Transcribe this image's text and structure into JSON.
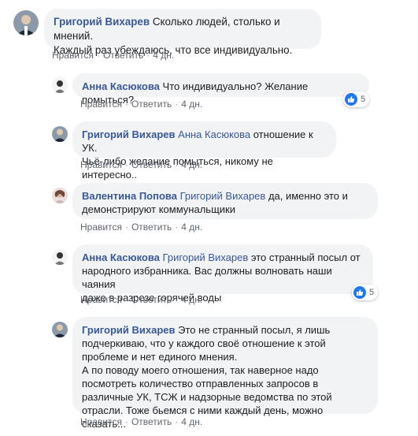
{
  "comments": [
    {
      "author": "Григорий Вихарев",
      "mention": "",
      "text": " Сколько людей, столько и мнений.\nКаждый раз убеждаюсь, что все индивидуально.",
      "like": "Нравится",
      "reply": "Ответить",
      "time": "4 дн.",
      "reactions": ""
    },
    {
      "author": "Анна Касюкова",
      "mention": "",
      "text": " Что индивидуально? Желание помыться?",
      "like": "Нравится",
      "reply": "Ответить",
      "time": "4 дн.",
      "reactions": "5"
    },
    {
      "author": "Григорий Вихарев",
      "mention": " Анна Касюкова",
      "text": " отношение к УК.\nЧьё-либо желание помыться, никому не интересно..",
      "like": "Нравится",
      "reply": "Ответить",
      "time": "4 дн.",
      "reactions": ""
    },
    {
      "author": "Валентина Попова",
      "mention": " Григорий Вихарев",
      "text": " да, именно это и\nдемонстрируют коммунальщики",
      "like": "Нравится",
      "reply": "Ответить",
      "time": "4 дн.",
      "reactions": ""
    },
    {
      "author": "Анна Касюкова",
      "mention": " Григорий Вихарев",
      "text": " это странный посыл от\nнародного избранника. Вас должны волновать наши чаяния\nдаже в разрезе горячей воды",
      "like": "Нравится",
      "reply": "Ответить",
      "time": "4 дн.",
      "reactions": "5"
    },
    {
      "author": "Григорий Вихарев",
      "mention": "",
      "text": " Это не странный посыл, я лишь\nподчеркиваю, что у каждого своё отношение к этой\nпроблеме и нет единого мнения.\nА по поводу моего отношения, так наверное надо\nпосмотреть количество отправленных запросов в\nразличные УК, ТСЖ и надзорные ведомства по этой\nотрасли. Тоже бьемся с ними каждый день, можно сказать...",
      "like": "Нравится",
      "reply": "Ответить",
      "time": "4 дн.",
      "reactions": ""
    }
  ],
  "colors": {
    "author": "#385898",
    "bubble": "#f2f3f5",
    "like_badge": "#2078f4",
    "meta": "#606770"
  },
  "icons": {
    "like": "thumbs-up-icon"
  }
}
